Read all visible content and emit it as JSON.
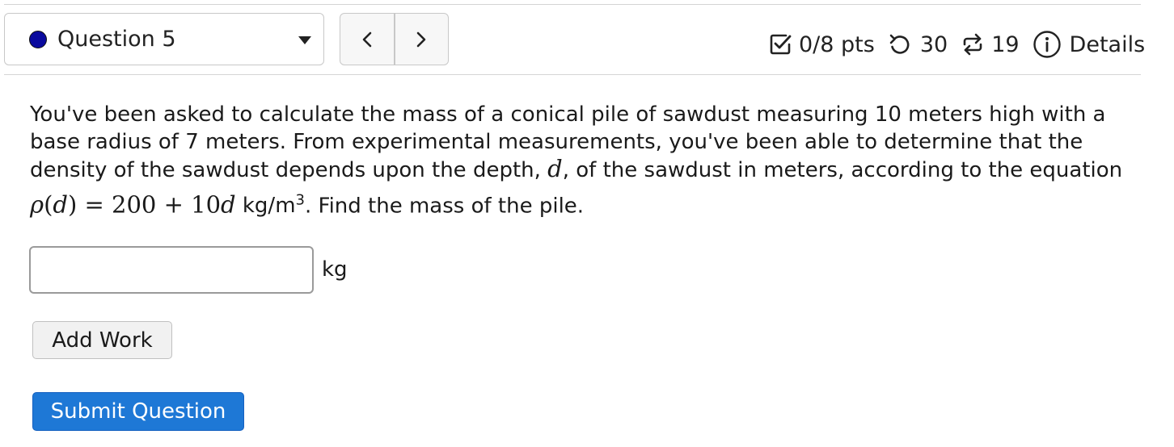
{
  "header": {
    "question_label": "Question 5",
    "nav_prev": "<",
    "nav_next": ">",
    "points": "0/8 pts",
    "attempts": "30",
    "retries": "19",
    "details": "Details"
  },
  "question": {
    "text_line1": "You've been asked to calculate the mass of a conical pile of sawdust measuring 10 meters high with a",
    "text_line2": "base radius of 7 meters. From experimental measurements, you've been able to determine that the",
    "text_line3": "density of the sawdust depends upon the depth, ",
    "var_d": "d",
    "text_line3_end": ", of the sawdust in meters, according to the equation",
    "eq_rho": "ρ",
    "eq_open": "(",
    "eq_d": "d",
    "eq_close": ")",
    "eq_equals": " = 200 + 10",
    "eq_d2": "d",
    "eq_units": "kg/m",
    "eq_exp": "3",
    "text_end": ". Find the mass of the pile."
  },
  "answer": {
    "value": "",
    "unit": "kg"
  },
  "buttons": {
    "add_work": "Add Work",
    "submit": "Submit Question"
  },
  "colors": {
    "status_dot": "#0a0a9e",
    "submit_bg": "#1e78d6"
  },
  "icons": [
    "checkbox-icon",
    "undo-icon",
    "repeat-icon",
    "info-icon"
  ]
}
